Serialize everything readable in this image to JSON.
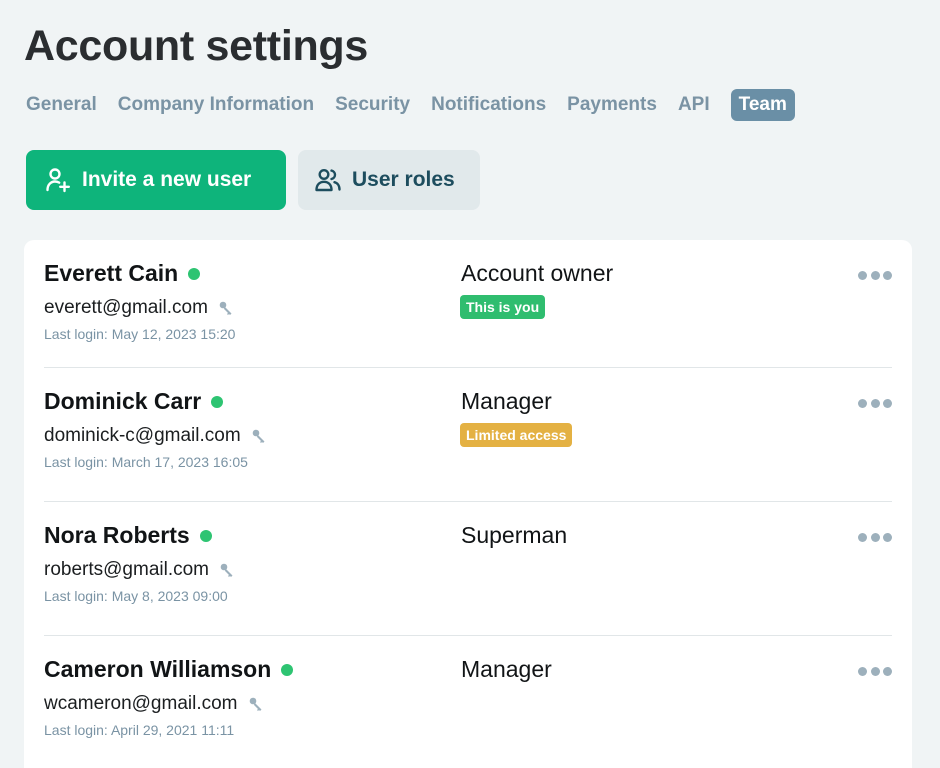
{
  "header": {
    "title": "Account settings"
  },
  "tabs": [
    {
      "label": "General",
      "active": false
    },
    {
      "label": "Company Information",
      "active": false
    },
    {
      "label": "Security",
      "active": false
    },
    {
      "label": "Notifications",
      "active": false
    },
    {
      "label": "Payments",
      "active": false
    },
    {
      "label": "API",
      "active": false
    },
    {
      "label": "Team",
      "active": true
    }
  ],
  "actions": {
    "invite_label": "Invite a new user",
    "invite_icon": "add-user-icon",
    "roles_label": "User roles",
    "roles_icon": "users-icon"
  },
  "colors": {
    "primary": "#0eb47b",
    "active_tab": "#6a8fa6",
    "online": "#2ec472",
    "badge_you": "#2fbd6f",
    "badge_limited": "#e4b143"
  },
  "users": [
    {
      "name": "Everett Cain",
      "online": true,
      "email": "everett@gmail.com",
      "last_login": "Last login: May 12, 2023 15:20",
      "role": "Account owner",
      "badge": "This is you",
      "badge_color": "#2fbd6f"
    },
    {
      "name": "Dominick Carr",
      "online": true,
      "email": "dominick-c@gmail.com",
      "last_login": "Last login: March 17, 2023 16:05",
      "role": "Manager",
      "badge": "Limited access",
      "badge_color": "#e4b143"
    },
    {
      "name": "Nora Roberts",
      "online": true,
      "email": "roberts@gmail.com",
      "last_login": "Last login: May 8, 2023 09:00",
      "role": "Superman",
      "badge": "",
      "badge_color": ""
    },
    {
      "name": "Cameron Williamson",
      "online": true,
      "email": "wcameron@gmail.com",
      "last_login": "Last login: April 29, 2021 11:11",
      "role": "Manager",
      "badge": "",
      "badge_color": ""
    }
  ]
}
